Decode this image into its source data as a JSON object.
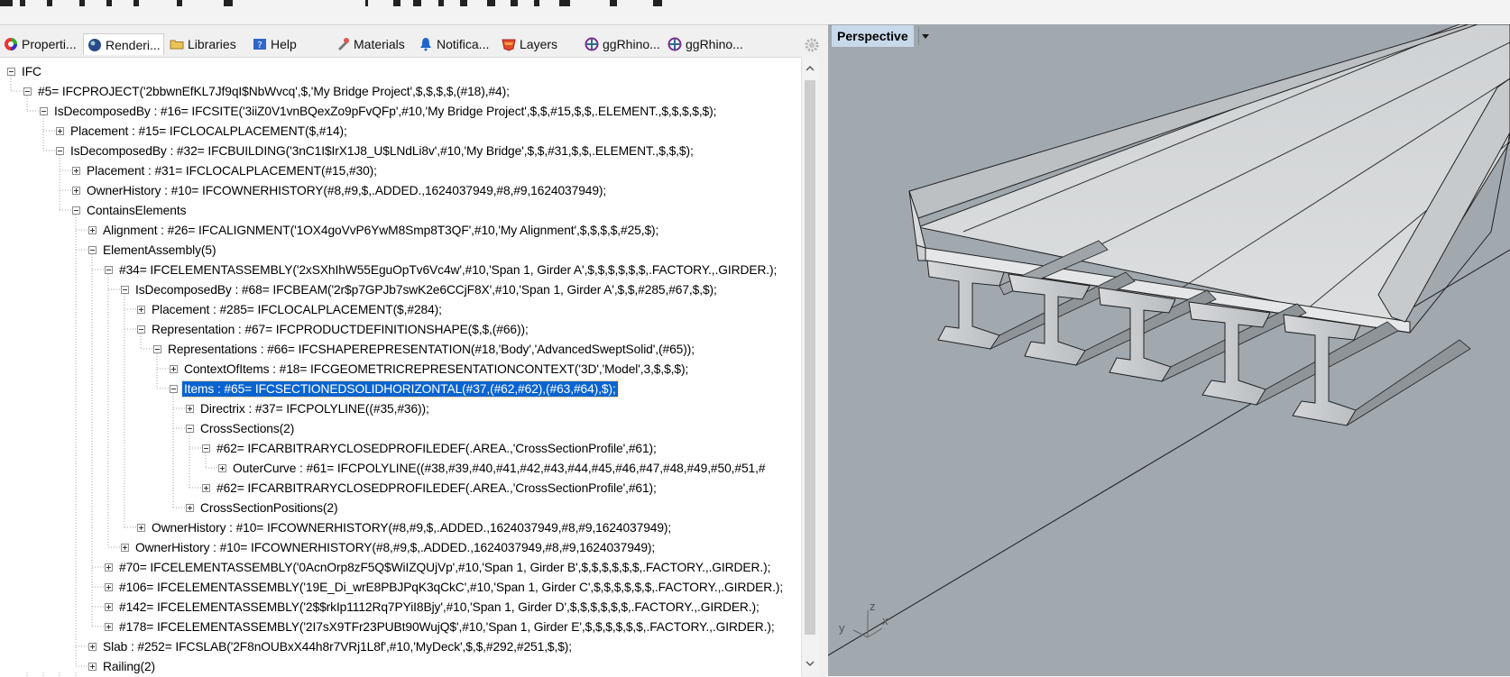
{
  "tabs": [
    {
      "label": "Properti...",
      "icon": "properties-icon"
    },
    {
      "label": "Renderi...",
      "icon": "rendering-icon"
    },
    {
      "label": "Libraries",
      "icon": "libraries-folder-icon"
    },
    {
      "label": "Help",
      "icon": "help-icon"
    },
    {
      "label": "Materials",
      "icon": "materials-icon"
    },
    {
      "label": "Notifica...",
      "icon": "notifications-icon"
    },
    {
      "label": "Layers",
      "icon": "layers-icon"
    },
    {
      "label": "ggRhino...",
      "icon": "ggrhino-icon"
    },
    {
      "label": "ggRhino...",
      "icon": "ggrhino-icon"
    }
  ],
  "tree": {
    "nodes": [
      {
        "text": "IFC",
        "level": 0,
        "toggle": "minus"
      },
      {
        "text": "#5= IFCPROJECT('2bbwnEfKL7Jf9qI$NbWvcq',$,'My Bridge Project',$,$,$,$,(#18),#4);",
        "level": 1,
        "toggle": "minus"
      },
      {
        "text": "IsDecomposedBy : #16= IFCSITE('3iiZ0V1vnBQexZo9pFvQFp',#10,'My Bridge Project',$,$,#15,$,$,.ELEMENT.,$,$,$,$,$);",
        "level": 2,
        "toggle": "minus"
      },
      {
        "text": "Placement : #15= IFCLOCALPLACEMENT($,#14);",
        "level": 3,
        "toggle": "plus"
      },
      {
        "text": "IsDecomposedBy : #32= IFCBUILDING('3nC1I$IrX1J8_U$LNdLi8v',#10,'My Bridge',$,$,#31,$,$,.ELEMENT.,$,$,$);",
        "level": 3,
        "toggle": "minus"
      },
      {
        "text": "Placement : #31= IFCLOCALPLACEMENT(#15,#30);",
        "level": 4,
        "toggle": "plus"
      },
      {
        "text": "OwnerHistory : #10= IFCOWNERHISTORY(#8,#9,$,.ADDED.,1624037949,#8,#9,1624037949);",
        "level": 4,
        "toggle": "plus"
      },
      {
        "text": "ContainsElements",
        "level": 4,
        "toggle": "minus"
      },
      {
        "text": "Alignment : #26= IFCALIGNMENT('1OX4goVvP6YwM8Smp8T3QF',#10,'My Alignment',$,$,$,$,#25,$);",
        "level": 5,
        "toggle": "plus"
      },
      {
        "text": "ElementAssembly(5)",
        "level": 5,
        "toggle": "minus"
      },
      {
        "text": "#34= IFCELEMENTASSEMBLY('2xSXhIhW55EguOpTv6Vc4w',#10,'Span 1, Girder A',$,$,$,$,$,$,.FACTORY.,.GIRDER.);",
        "level": 6,
        "toggle": "minus"
      },
      {
        "text": "IsDecomposedBy : #68= IFCBEAM('2r$p7GPJb7swK2e6CCjF8X',#10,'Span 1, Girder A',$,$,#285,#67,$,$);",
        "level": 7,
        "toggle": "minus"
      },
      {
        "text": "Placement : #285= IFCLOCALPLACEMENT($,#284);",
        "level": 8,
        "toggle": "plus"
      },
      {
        "text": "Representation : #67= IFCPRODUCTDEFINITIONSHAPE($,$,(#66));",
        "level": 8,
        "toggle": "minus"
      },
      {
        "text": "Representations : #66= IFCSHAPEREPRESENTATION(#18,'Body','AdvancedSweptSolid',(#65));",
        "level": 9,
        "toggle": "minus"
      },
      {
        "text": "ContextOfItems : #18= IFCGEOMETRICREPRESENTATIONCONTEXT('3D','Model',3,$,$,$);",
        "level": 10,
        "toggle": "plus"
      },
      {
        "text": "Items : #65= IFCSECTIONEDSOLIDHORIZONTAL(#37,(#62,#62),(#63,#64),$);",
        "level": 10,
        "toggle": "minus",
        "selected": true
      },
      {
        "text": "Directrix : #37= IFCPOLYLINE((#35,#36));",
        "level": 11,
        "toggle": "plus"
      },
      {
        "text": "CrossSections(2)",
        "level": 11,
        "toggle": "minus"
      },
      {
        "text": "#62= IFCARBITRARYCLOSEDPROFILEDEF(.AREA.,'CrossSectionProfile',#61);",
        "level": 12,
        "toggle": "minus"
      },
      {
        "text": "OuterCurve : #61= IFCPOLYLINE((#38,#39,#40,#41,#42,#43,#44,#45,#46,#47,#48,#49,#50,#51,#",
        "level": 13,
        "toggle": "plus"
      },
      {
        "text": "#62= IFCARBITRARYCLOSEDPROFILEDEF(.AREA.,'CrossSectionProfile',#61);",
        "level": 12,
        "toggle": "plus"
      },
      {
        "text": "CrossSectionPositions(2)",
        "level": 11,
        "toggle": "plus"
      },
      {
        "text": "OwnerHistory : #10= IFCOWNERHISTORY(#8,#9,$,.ADDED.,1624037949,#8,#9,1624037949);",
        "level": 8,
        "toggle": "plus"
      },
      {
        "text": "OwnerHistory : #10= IFCOWNERHISTORY(#8,#9,$,.ADDED.,1624037949,#8,#9,1624037949);",
        "level": 7,
        "toggle": "plus"
      },
      {
        "text": "#70= IFCELEMENTASSEMBLY('0AcnOrp8zF5Q$WiIZQUjVp',#10,'Span 1, Girder B',$,$,$,$,$,$,.FACTORY.,.GIRDER.);",
        "level": 6,
        "toggle": "plus"
      },
      {
        "text": "#106= IFCELEMENTASSEMBLY('19E_Di_wrE8PBJPqK3qCkC',#10,'Span 1, Girder C',$,$,$,$,$,$,.FACTORY.,.GIRDER.);",
        "level": 6,
        "toggle": "plus"
      },
      {
        "text": "#142= IFCELEMENTASSEMBLY('2$$rkIp1112Rq7PYiI8Bjy',#10,'Span 1, Girder D',$,$,$,$,$,$,.FACTORY.,.GIRDER.);",
        "level": 6,
        "toggle": "plus"
      },
      {
        "text": "#178= IFCELEMENTASSEMBLY('2I7sX9TFr23PUBt90WujQ$',#10,'Span 1, Girder E',$,$,$,$,$,$,.FACTORY.,.GIRDER.);",
        "level": 6,
        "toggle": "plus"
      },
      {
        "text": "Slab : #252= IFCSLAB('2F8nOUBxX44h8r7VRj1L8f',#10,'MyDeck',$,$,#292,#251,$,$);",
        "level": 5,
        "toggle": "plus"
      },
      {
        "text": "Railing(2)",
        "level": 5,
        "toggle": "plus"
      }
    ]
  },
  "viewport": {
    "label": "Perspective",
    "axes": {
      "x": "x",
      "y": "y",
      "z": "z"
    }
  },
  "colors": {
    "selection": "#0a64d0",
    "viewport_bg": "#a1a8ae",
    "viewport_label_bg": "#c8d9ea"
  }
}
